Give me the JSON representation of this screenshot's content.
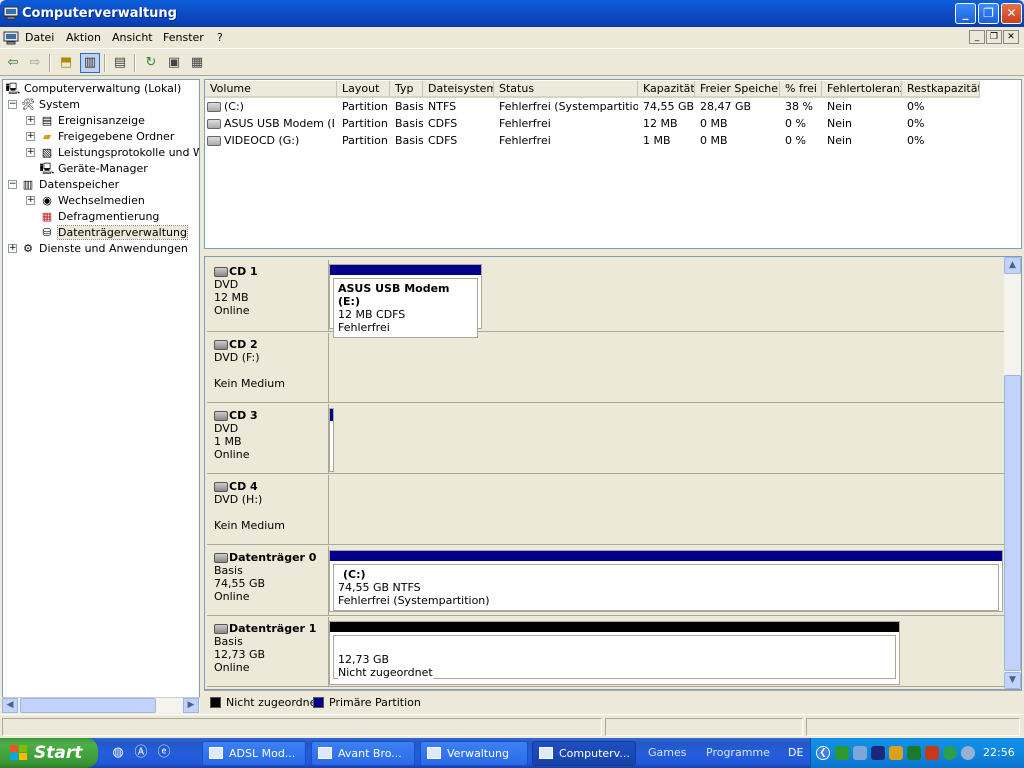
{
  "window": {
    "title": "Computerverwaltung",
    "controls": {
      "minimize": "_",
      "maximize": "❐",
      "close": "✕"
    }
  },
  "menu": {
    "items": [
      "Datei",
      "Aktion",
      "Ansicht",
      "Fenster",
      "?"
    ]
  },
  "tree": {
    "root": "Computerverwaltung (Lokal)",
    "system": "System",
    "ereignisanzeige": "Ereignisanzeige",
    "freigegebene_ordner": "Freigegebene Ordner",
    "leistungsprotokolle": "Leistungsprotokolle und Warn",
    "geraete_manager": "Geräte-Manager",
    "datenspeicher": "Datenspeicher",
    "wechselmedien": "Wechselmedien",
    "defragmentierung": "Defragmentierung",
    "datentraegerverwaltung": "Datenträgerverwaltung",
    "dienste": "Dienste und Anwendungen"
  },
  "volume_list": {
    "columns": [
      "Volume",
      "Layout",
      "Typ",
      "Dateisystem",
      "Status",
      "Kapazität",
      "Freier Speicher",
      "% frei",
      "Fehlertoleranz",
      "Restkapazität"
    ],
    "rows": [
      [
        "(C:)",
        "Partition",
        "Basis",
        "NTFS",
        "Fehlerfrei (Systempartition)",
        "74,55 GB",
        "28,47 GB",
        "38 %",
        "Nein",
        "0%"
      ],
      [
        "ASUS USB Modem (E:)",
        "Partition",
        "Basis",
        "CDFS",
        "Fehlerfrei",
        "12 MB",
        "0 MB",
        "0 %",
        "Nein",
        "0%"
      ],
      [
        "VIDEOCD (G:)",
        "Partition",
        "Basis",
        "CDFS",
        "Fehlerfrei",
        "1 MB",
        "0 MB",
        "0 %",
        "Nein",
        "0%"
      ]
    ]
  },
  "disks": [
    {
      "name": "CD 1",
      "line1": "DVD",
      "line2": "12 MB",
      "line3": "Online",
      "partition": {
        "title": "ASUS USB Modem  (E:)",
        "line1": "12 MB CDFS",
        "line2": "Fehlerfrei"
      }
    },
    {
      "name": "CD 2",
      "line1": "DVD (F:)",
      "line2": "",
      "line3": "Kein Medium"
    },
    {
      "name": "CD 3",
      "line1": "DVD",
      "line2": "1 MB",
      "line3": "Online"
    },
    {
      "name": "CD 4",
      "line1": "DVD (H:)",
      "line2": "",
      "line3": "Kein Medium"
    },
    {
      "name": "Datenträger 0",
      "line1": "Basis",
      "line2": "74,55 GB",
      "line3": "Online",
      "partition": {
        "title": "(C:)",
        "line1": "74,55 GB NTFS",
        "line2": "Fehlerfrei (Systempartition)"
      }
    },
    {
      "name": "Datenträger 1",
      "line1": "Basis",
      "line2": "12,73 GB",
      "line3": "Online",
      "partition": {
        "title": "",
        "line1": "12,73 GB",
        "line2": "Nicht zugeordnet"
      }
    }
  ],
  "legend": {
    "unallocated": "Nicht zugeordnet",
    "primary": "Primäre Partition",
    "colors": {
      "unallocated": "#000000",
      "primary": "#00008b"
    }
  },
  "taskbar": {
    "start": "Start",
    "tasks": [
      "ADSL Mod...",
      "Avant Bro...",
      "Verwaltung",
      "Computerv..."
    ],
    "links": [
      "Games",
      "Programme"
    ],
    "language": "DE",
    "clock": "22:56"
  }
}
